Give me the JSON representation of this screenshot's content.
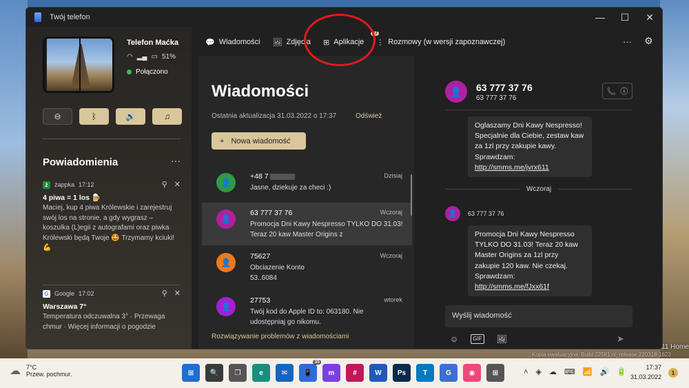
{
  "window": {
    "title": "Twój telefon",
    "controls": {
      "minimize": "—",
      "maximize": "☐",
      "close": "✕"
    }
  },
  "phone": {
    "name": "Telefon Maćka",
    "battery": "51%",
    "connection": "Połączono"
  },
  "quick_actions": {
    "dnd_icon": "⊖",
    "bluetooth_icon": "ᛒ",
    "volume_icon": "🔊",
    "music_icon": "♫"
  },
  "notifications": {
    "title": "Powiadomienia",
    "more": "···",
    "items": [
      {
        "app": "żappka",
        "time": "17:12",
        "title": "4 piwa = 1 los 🍺",
        "body": "Maciej, kup 4 piwa Królewskie i zarejestruj swój los na stronie, a gdy wygrasz – koszulka (L)egii z autografami oraz piwka Królewski będą Twoje 🤩 Trzymamy kciuki! 💪"
      },
      {
        "app": "Google",
        "time": "17:02",
        "title": "Warszawa 7°",
        "body": "Temperatura odczuwalna 3° · Przewaga chmur · Więcej informacji o pogodzie"
      }
    ]
  },
  "tabs": [
    {
      "label": "Wiadomości",
      "icon": "💬"
    },
    {
      "label": "Zdjęcia",
      "icon": "🖼"
    },
    {
      "label": "Aplikacje",
      "icon": "⊞"
    },
    {
      "label": "Rozmowy (w wersji zapoznawczej)",
      "icon": "⋮",
      "badge": "27"
    }
  ],
  "header_actions": {
    "more": "···",
    "settings": "⚙"
  },
  "messages": {
    "heading": "Wiadomości",
    "last_update": "Ostatnia aktualizacja 31.03.2022 o 17:37",
    "refresh": "Odśwież",
    "new_message": "Nowa wiadomość",
    "new_message_icon": "+",
    "troubleshoot": "Rozwiązywanie problemów z wiadomościami",
    "conversations": [
      {
        "name": "+48 7",
        "date": "Dzisiaj",
        "preview": "Jasne, dziekuje za checi :)",
        "color": "#2e9b45"
      },
      {
        "name": "63 777 37 76",
        "date": "Wczoraj",
        "preview": "Promocja Dni Kawy Nespresso TYLKO DO 31.03! Teraz 20 kaw Master Origins z",
        "color": "#b01fa0"
      },
      {
        "name": "75627",
        "date": "Wczoraj",
        "preview": "Obciazenie Konto 53..6084",
        "color": "#f07a1a"
      },
      {
        "name": "27753",
        "date": "wtorek",
        "preview": "Twój kod do Apple ID to: 063180. Nie udostępniaj go nikomu.",
        "color": "#a51ed6"
      }
    ]
  },
  "conversation": {
    "name": "63 777 37 76",
    "number": "63 777 37 76",
    "call_icon": "📞",
    "info_icon": "ⓘ",
    "bubble1": {
      "text": "Oglaszamy Dni Kawy Nespresso! Specjalnie dla Ciebie, zestaw kaw za 1zl przy zakupie kawy. Sprawdzam:",
      "link": "http://smms.me/jvrx611"
    },
    "day_separator": "Wczoraj",
    "sender": "63 777 37 76",
    "bubble2": {
      "text": "Promocja Dni Kawy Nespresso TYLKO DO 31.03! Teraz 20 kaw Master Origins za 1zl przy zakupie 120 kaw. Nie czekaj. Sprawdzam:",
      "link": "http://smms.me/fJxx61f"
    },
    "compose_placeholder": "Wyślij wiadomość",
    "tools": {
      "emoji": "☺",
      "gif": "GIF",
      "image": "🖼"
    },
    "send_icon": "➤"
  },
  "background_text": {
    "home": "11 Home",
    "build": "Kopia ewaluacyjna. Build 22581.ni_release.220318-1623"
  },
  "taskbar": {
    "weather_temp": "7°C",
    "weather_desc": "Przew. pochmur.",
    "weather_icon": "☁",
    "apps": [
      {
        "name": "start",
        "label": "⊞",
        "color": "#1f6fd1"
      },
      {
        "name": "search",
        "label": "🔍",
        "color": "#3a3a3a"
      },
      {
        "name": "task-view",
        "label": "❐",
        "color": "#555"
      },
      {
        "name": "edge",
        "label": "e",
        "color": "#1a8e7e"
      },
      {
        "name": "mail",
        "label": "✉",
        "color": "#1565c0"
      },
      {
        "name": "phone",
        "label": "📱",
        "color": "#2f6bd8",
        "count": "35"
      },
      {
        "name": "messenger",
        "label": "m",
        "color": "#7b3fe0"
      },
      {
        "name": "slack",
        "label": "#",
        "color": "#c2185b"
      },
      {
        "name": "word",
        "label": "W",
        "color": "#1e5bb8"
      },
      {
        "name": "photoshop",
        "label": "Ps",
        "color": "#0a2a4d"
      },
      {
        "name": "trello",
        "label": "T",
        "color": "#0079bf"
      },
      {
        "name": "translator",
        "label": "G",
        "color": "#3d6fd1"
      },
      {
        "name": "paint",
        "label": "◉",
        "color": "#e94a7a"
      },
      {
        "name": "store",
        "label": "⊞",
        "color": "#555"
      }
    ],
    "tray_icons": [
      "˄",
      "◈",
      "☁",
      "⌨",
      "📶",
      "🔊",
      "🔋"
    ],
    "time": "17:37",
    "date": "31.03.2022",
    "notif_count": "1"
  }
}
